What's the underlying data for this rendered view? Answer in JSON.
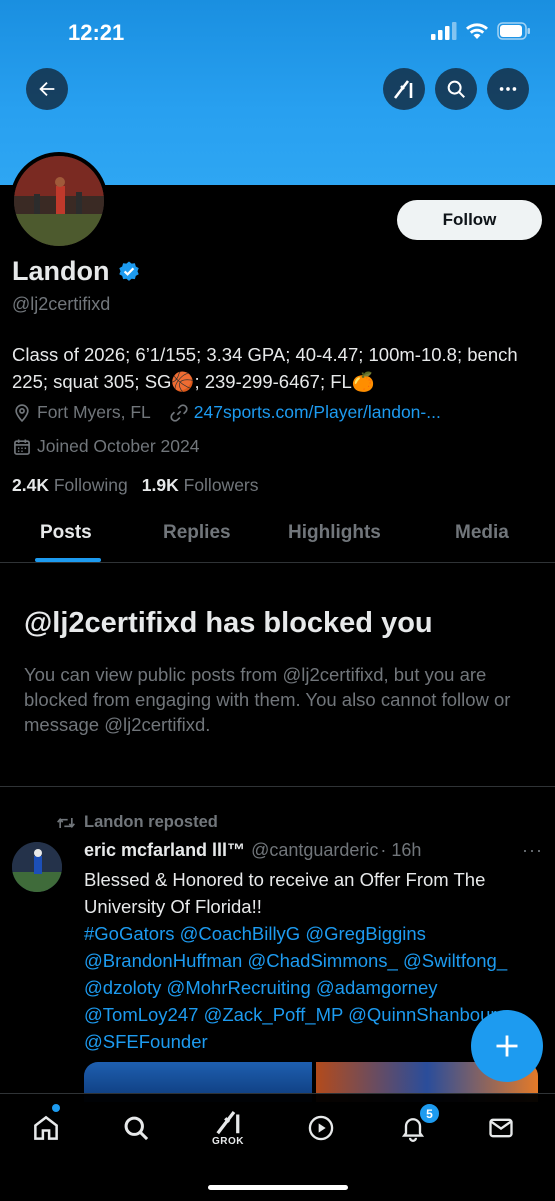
{
  "status_bar": {
    "time": "12:21"
  },
  "profile": {
    "name": "Landon",
    "handle": "@lj2certifixd",
    "follow_label": "Follow",
    "bio": "Class of 2026; 6’1/155; 3.34 GPA; 40-4.47; 100m-10.8; bench 225; squat 305; SG🏀; 239-299-6467; FL🍊",
    "location": "Fort Myers, FL",
    "website": "247sports.com/Player/landon-...",
    "joined": "Joined October 2024",
    "following_count": "2.4K",
    "following_label": "Following",
    "followers_count": "1.9K",
    "followers_label": "Followers"
  },
  "tabs": [
    {
      "label": "Posts",
      "active": true
    },
    {
      "label": "Replies",
      "active": false
    },
    {
      "label": "Highlights",
      "active": false
    },
    {
      "label": "Media",
      "active": false
    }
  ],
  "blocked": {
    "title": "@lj2certifixd has blocked you",
    "message": "You can view public posts from @lj2certifixd, but you are blocked from engaging with them. You also cannot follow or message @lj2certifixd."
  },
  "tweet": {
    "repost_label": "Landon reposted",
    "author_name": "eric mcfarland lll™",
    "author_handle": "@cantguarderic",
    "time": "· 16h",
    "more": "···",
    "text": "Blessed & Honored to receive an Offer From The University Of Florida!!",
    "tags": "#GoGators @CoachBillyG @GregBiggins @BrandonHuffman @ChadSimmons_ @Swiltfong_ @dzoloty @MohrRecruiting @adamgorney @TomLoy247 @Zack_Poff_MP @QuinnShanbour @SFEFounder"
  },
  "bottom_nav": {
    "grok_label": "GROK",
    "notifications_badge": "5"
  },
  "icons": {
    "back": "back-arrow-icon",
    "grok": "grok-icon",
    "search": "search-icon",
    "more": "more-icon",
    "verified": "verified-badge-icon",
    "location": "location-icon",
    "link": "link-icon",
    "calendar": "calendar-icon",
    "repost": "repost-icon",
    "compose": "plus-icon",
    "home": "home-icon",
    "video": "play-icon",
    "notifications": "bell-icon",
    "messages": "mail-icon"
  },
  "colors": {
    "accent": "#1d9bf0",
    "banner": "#28a0f0",
    "background": "#000000",
    "secondary_text": "#71767b"
  }
}
